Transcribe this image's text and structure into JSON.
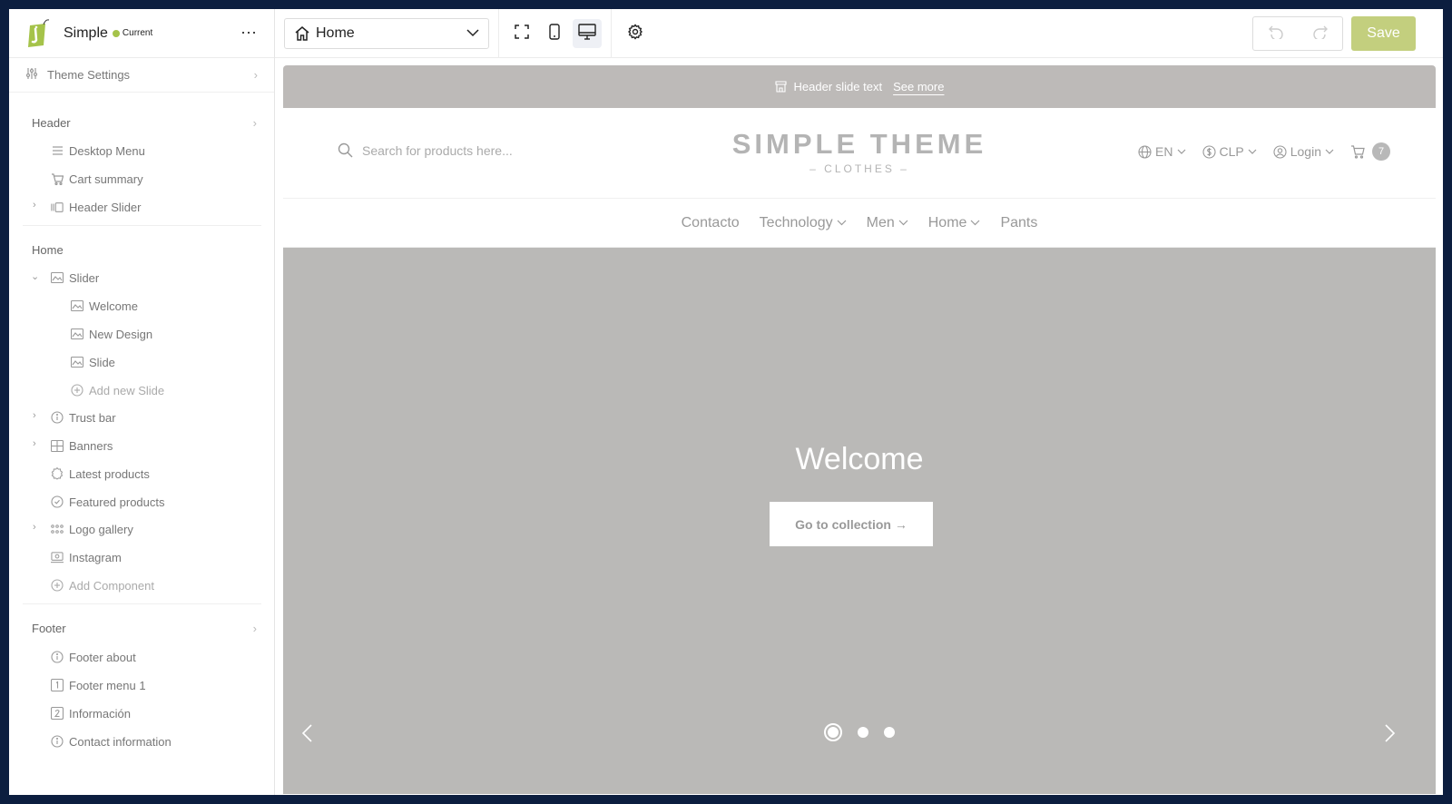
{
  "app": {
    "name": "Simple",
    "badge": "Current"
  },
  "sidebar": {
    "theme_settings": "Theme Settings",
    "header": {
      "title": "Header",
      "items": [
        "Desktop Menu",
        "Cart summary",
        "Header Slider"
      ]
    },
    "home": {
      "title": "Home",
      "slider": "Slider",
      "slides": [
        "Welcome",
        "New Design",
        "Slide"
      ],
      "add_slide": "Add new Slide",
      "items": [
        "Trust bar",
        "Banners",
        "Latest products",
        "Featured products",
        "Logo gallery",
        "Instagram"
      ],
      "add_component": "Add Component"
    },
    "footer": {
      "title": "Footer",
      "items": [
        "Footer about",
        "Footer menu 1",
        "Información",
        "Contact information"
      ]
    }
  },
  "toolbar": {
    "page": "Home",
    "save_label": "Save"
  },
  "preview": {
    "promo_text": "Header slide text",
    "promo_link": "See more",
    "search_placeholder": "Search for products here...",
    "brand_name": "SIMPLE THEME",
    "brand_sub": "– CLOTHES –",
    "language": "EN",
    "currency": "CLP",
    "login": "Login",
    "cart_count": "7",
    "nav": [
      "Contacto",
      "Technology",
      "Men",
      "Home",
      "Pants"
    ],
    "hero_title": "Welcome",
    "hero_button": "Go to collection →",
    "active_slide": 1,
    "slide_count": 3
  },
  "colors": {
    "accent": "#a5c34a",
    "save_button": "#c3cf7e",
    "promo_bar": "#bdbab8",
    "hero_bg": "#bab9b7",
    "page_bg": "#0c1e3f"
  }
}
